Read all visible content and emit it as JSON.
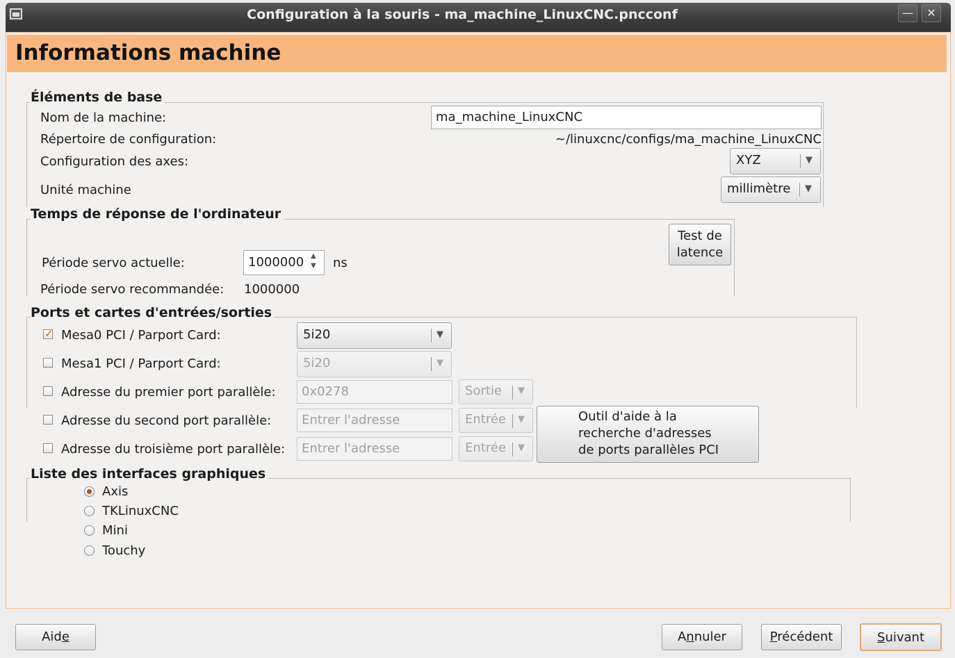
{
  "window": {
    "title": "Configuration à la souris - ma_machine_LinuxCNC.pncconf",
    "minimize_glyph": "—",
    "close_glyph": "✕"
  },
  "page": {
    "title": "Informations machine"
  },
  "basic": {
    "title": "Éléments de base",
    "machine_name_label": "Nom de la machine:",
    "machine_name_value": "ma_machine_LinuxCNC",
    "config_dir_label": "Répertoire de configuration:",
    "config_dir_value": "~/linuxcnc/configs/ma_machine_LinuxCNC",
    "axes_label": "Configuration des axes:",
    "axes_value": "XYZ",
    "units_label": "Unité machine",
    "units_value": "millimètre"
  },
  "latency": {
    "title": "Temps de réponse de l'ordinateur",
    "test_button_line1": "Test de",
    "test_button_line2": "latence",
    "servo_label": "Période servo actuelle:",
    "servo_value": "1000000",
    "servo_unit": "ns",
    "recommended_label": "Période servo recommandée:",
    "recommended_value": "1000000"
  },
  "io": {
    "title": "Ports et cartes d'entrées/sorties",
    "mesa0_label": "Mesa0 PCI / Parport Card:",
    "mesa0_value": "5i20",
    "mesa0_checked": true,
    "mesa1_label": "Mesa1 PCI / Parport Card:",
    "mesa1_value": "5i20",
    "pp1_label": "Adresse du premier port parallèle:",
    "pp1_value": "0x0278",
    "pp1_dir": "Sortie",
    "pp2_label": "Adresse du second port parallèle:",
    "pp2_placeholder": "Entrer l'adresse",
    "pp2_dir": "Entrée",
    "pp3_label": "Adresse du troisième port parallèle:",
    "pp3_placeholder": "Entrer l'adresse",
    "pp3_dir": "Entrée",
    "helper_line1": "Outil d'aide à la",
    "helper_line2": "recherche d'adresses",
    "helper_line3": "de ports parallèles PCI"
  },
  "gui": {
    "title": "Liste des interfaces graphiques",
    "options": [
      "Axis",
      "TKLinuxCNC",
      "Mini",
      "Touchy"
    ],
    "selected": "Axis"
  },
  "footer": {
    "help_pre": "Aid",
    "help_u": "e",
    "cancel_pre": "A",
    "cancel_u": "n",
    "cancel_post": "nuler",
    "prev_u": "P",
    "prev_post": "récédent",
    "next_u": "S",
    "next_post": "uivant"
  }
}
